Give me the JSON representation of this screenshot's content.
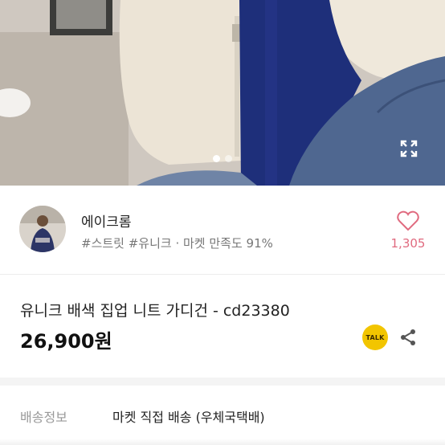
{
  "hero": {
    "image_alt": "product photo",
    "slide_count": 2,
    "active_slide": 1,
    "expand_icon": "expand-icon"
  },
  "shop": {
    "name": "에이크롬",
    "tags": "#스트릿 #유니크 · 마켓 만족도 91%",
    "like_count": "1,305",
    "like_icon": "heart-icon",
    "accent_color": "#e06a7f"
  },
  "product": {
    "title": "유니크 배색 집업 니트 가디건 - cd23380",
    "price": "26,900원"
  },
  "actions": {
    "talk_label": "TALK",
    "talk_color": "#f2c500",
    "share_icon": "share-icon"
  },
  "shipping": {
    "label": "배송정보",
    "value": "마켓 직접 배송 (우체국택배)"
  }
}
